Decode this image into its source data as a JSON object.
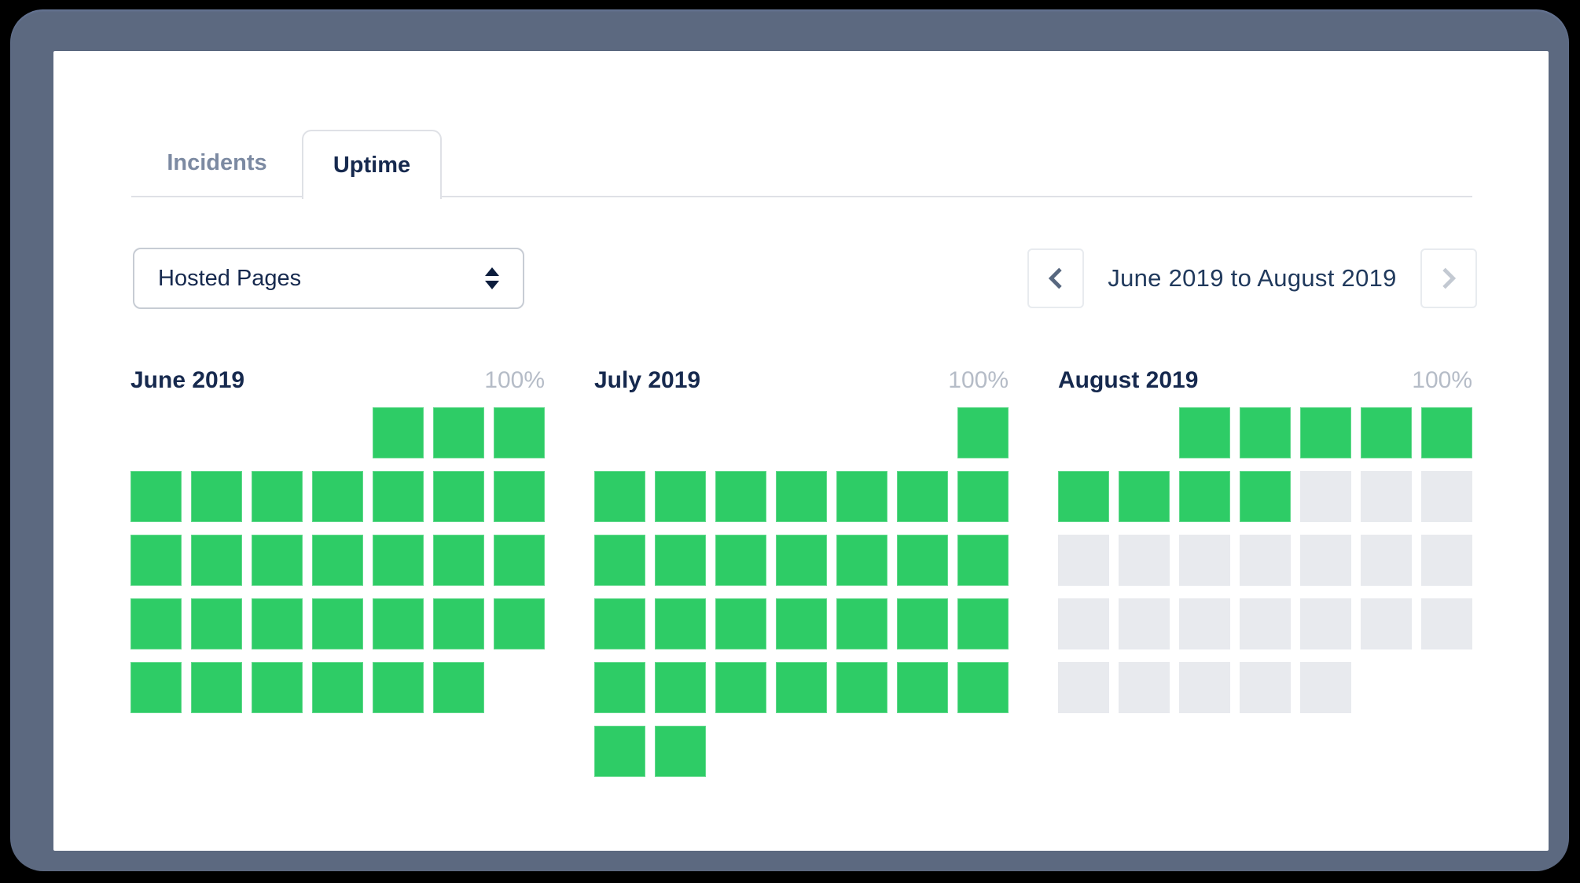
{
  "tabs": [
    {
      "label": "Incidents",
      "active": false
    },
    {
      "label": "Uptime",
      "active": true
    }
  ],
  "filter": {
    "selected_option": "Hosted Pages"
  },
  "nav": {
    "range_label": "June 2019 to August 2019",
    "prev_enabled": true,
    "next_enabled": false
  },
  "months": [
    {
      "title": "June 2019",
      "uptime": "100%",
      "weeks": [
        [
          "e",
          "e",
          "e",
          "e",
          "u",
          "u",
          "u"
        ],
        [
          "u",
          "u",
          "u",
          "u",
          "u",
          "u",
          "u"
        ],
        [
          "u",
          "u",
          "u",
          "u",
          "u",
          "u",
          "u"
        ],
        [
          "u",
          "u",
          "u",
          "u",
          "u",
          "u",
          "u"
        ],
        [
          "u",
          "u",
          "u",
          "u",
          "u",
          "u",
          "e"
        ]
      ]
    },
    {
      "title": "July 2019",
      "uptime": "100%",
      "weeks": [
        [
          "e",
          "e",
          "e",
          "e",
          "e",
          "e",
          "u"
        ],
        [
          "u",
          "u",
          "u",
          "u",
          "u",
          "u",
          "u"
        ],
        [
          "u",
          "u",
          "u",
          "u",
          "u",
          "u",
          "u"
        ],
        [
          "u",
          "u",
          "u",
          "u",
          "u",
          "u",
          "u"
        ],
        [
          "u",
          "u",
          "u",
          "u",
          "u",
          "u",
          "u"
        ],
        [
          "u",
          "u",
          "e",
          "e",
          "e",
          "e",
          "e"
        ]
      ]
    },
    {
      "title": "August 2019",
      "uptime": "100%",
      "weeks": [
        [
          "e",
          "e",
          "u",
          "u",
          "u",
          "u",
          "u"
        ],
        [
          "u",
          "u",
          "u",
          "u",
          "f",
          "f",
          "f"
        ],
        [
          "f",
          "f",
          "f",
          "f",
          "f",
          "f",
          "f"
        ],
        [
          "f",
          "f",
          "f",
          "f",
          "f",
          "f",
          "f"
        ],
        [
          "f",
          "f",
          "f",
          "f",
          "f",
          "e",
          "e"
        ]
      ]
    }
  ],
  "legend": {
    "up_state": "uptime-ok",
    "future_state": "no-data"
  },
  "colors": {
    "page_bg": "#000000",
    "frame_bg": "#5c6980",
    "green": "#2ecc66",
    "future": "#e8eaee",
    "navy": "#16294e",
    "muted": "#7c8aa2",
    "border": "#dfe1e6",
    "label_gray": "#b5bcc7"
  }
}
